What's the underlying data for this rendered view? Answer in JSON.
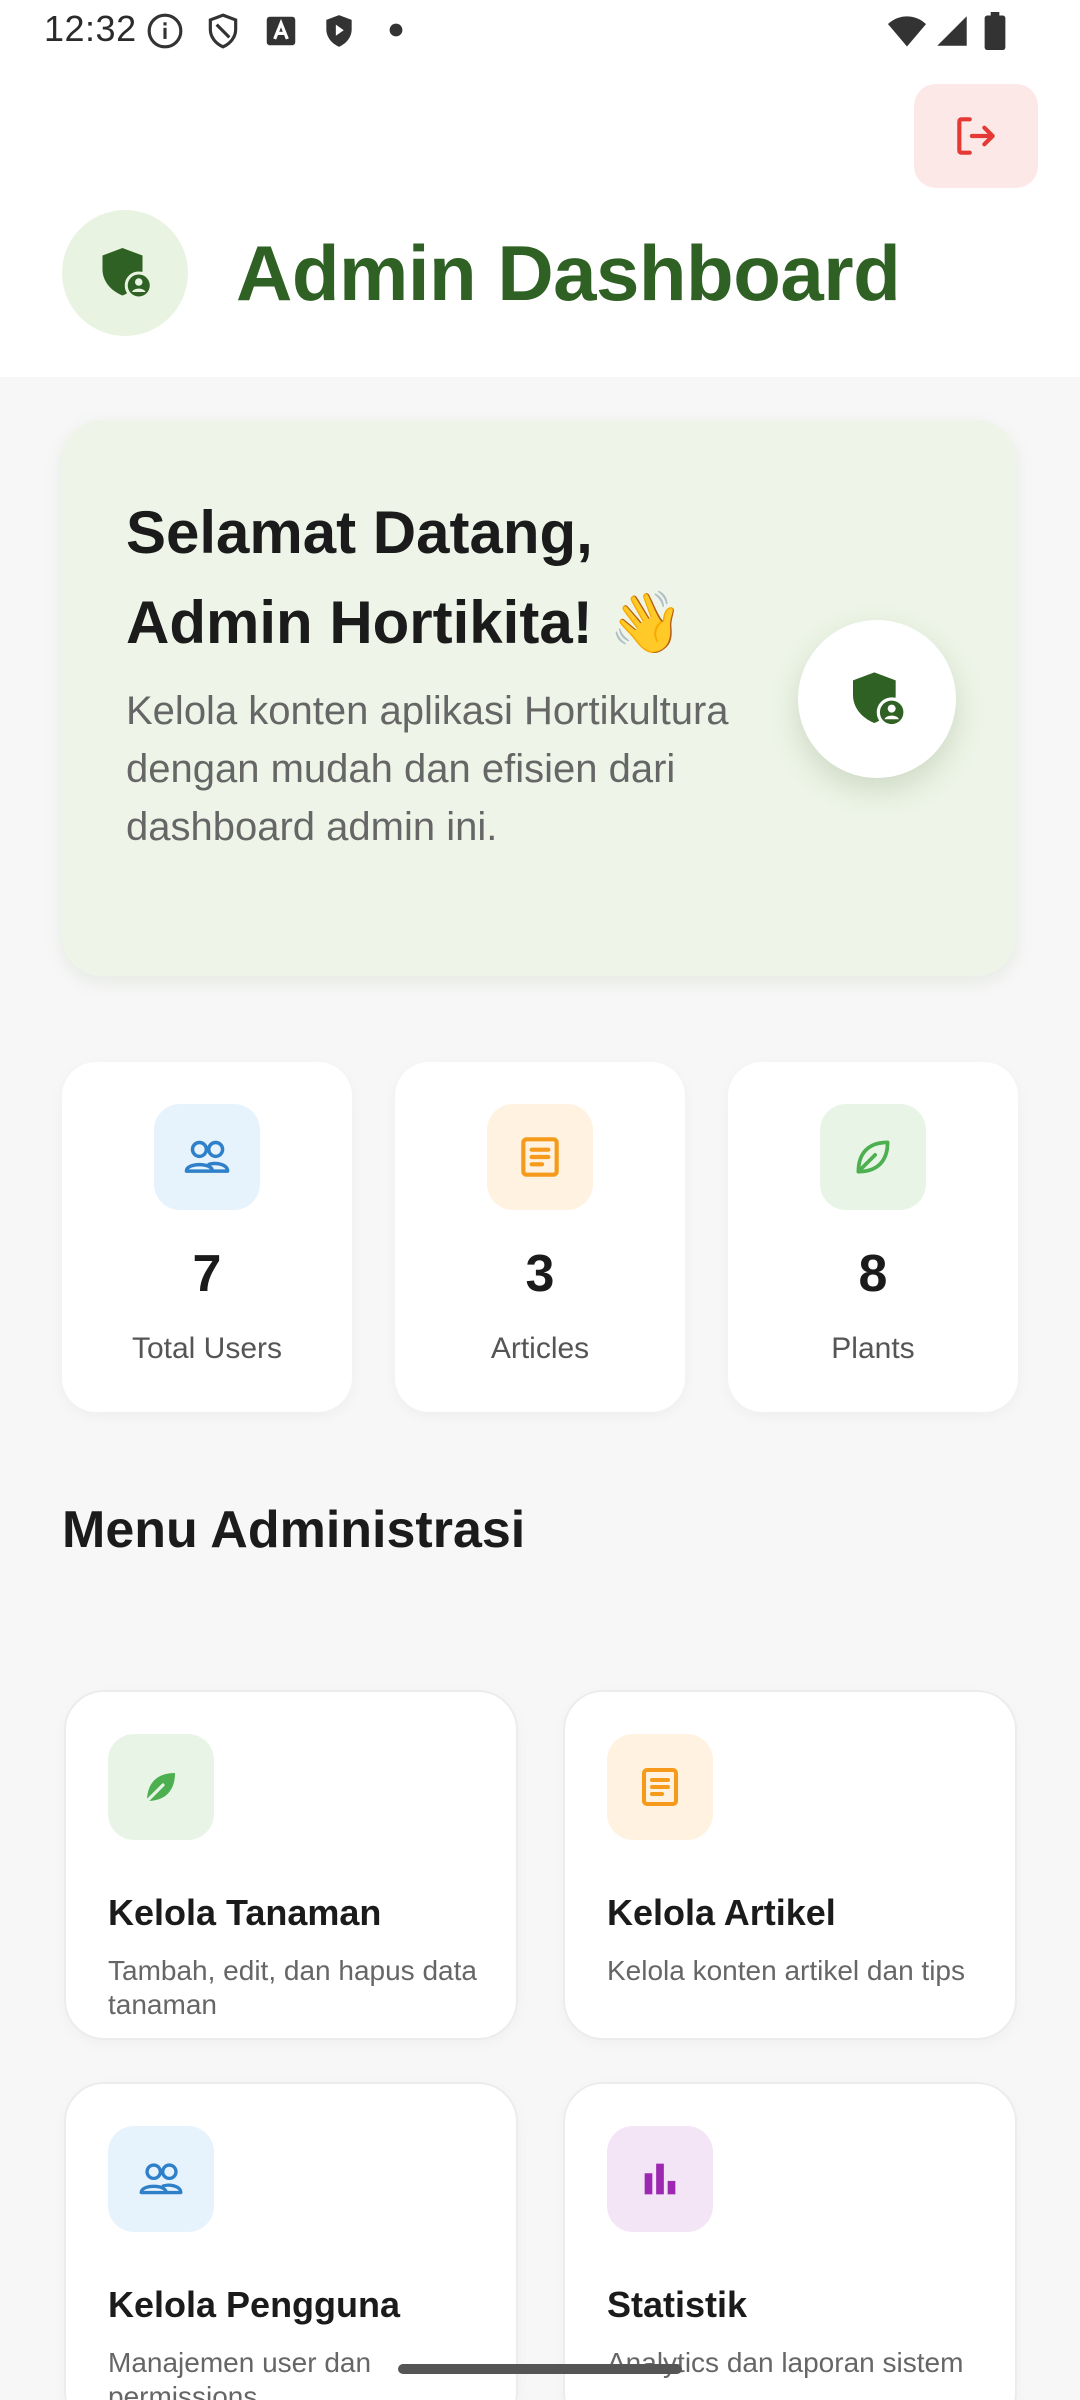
{
  "status_bar": {
    "time": "12:32"
  },
  "header": {
    "title": "Admin Dashboard",
    "logout_icon": "logout-icon",
    "avatar_icon": "admin-shield-icon"
  },
  "welcome": {
    "title_line1": "Selamat Datang,",
    "title_line2": "Admin Hortikita! 👋",
    "description": "Kelola konten aplikasi Hortikultura dengan mudah dan efisien dari dashboard admin ini.",
    "badge_icon": "admin-shield-icon"
  },
  "stats": [
    {
      "value": "7",
      "label": "Total Users",
      "icon": "users-icon",
      "color": "#2f80c8",
      "bg": "#e6f2fc"
    },
    {
      "value": "3",
      "label": "Articles",
      "icon": "article-icon",
      "color": "#f59a1b",
      "bg": "#fff2e0"
    },
    {
      "value": "8",
      "label": "Plants",
      "icon": "leaf-icon",
      "color": "#4caf50",
      "bg": "#e8f5e6"
    }
  ],
  "menu": {
    "section_title": "Menu Administrasi",
    "items": [
      {
        "title": "Kelola Tanaman",
        "description": "Tambah, edit, dan hapus data tanaman",
        "icon": "leaf-icon",
        "color": "#4caf50",
        "bg": "#e8f5e6"
      },
      {
        "title": "Kelola Artikel",
        "description": "Kelola konten artikel dan tips",
        "icon": "article-icon",
        "color": "#f59a1b",
        "bg": "#fff2e0"
      },
      {
        "title": "Kelola Pengguna",
        "description": "Manajemen user dan permissions",
        "icon": "users-icon",
        "color": "#2f80c8",
        "bg": "#e6f2fc"
      },
      {
        "title": "Statistik",
        "description": "Analytics dan laporan sistem",
        "icon": "bar-chart-icon",
        "color": "#9c27b0",
        "bg": "#f3e4f6"
      }
    ]
  },
  "colors": {
    "primary": "#2e6123",
    "logout": "#e53935",
    "logout_bg": "#fde8e8"
  }
}
